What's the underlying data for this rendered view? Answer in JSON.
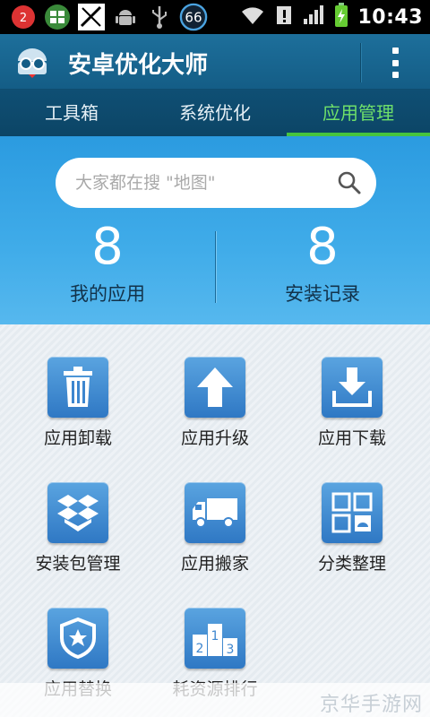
{
  "status_bar": {
    "notification_badge": "2",
    "signal_number": "66",
    "time": "10:43"
  },
  "app": {
    "title": "安卓优化大师",
    "logo_icon": "android-robot-glasses-icon"
  },
  "tabs": [
    {
      "label": "工具箱",
      "active": false
    },
    {
      "label": "系统优化",
      "active": false
    },
    {
      "label": "应用管理",
      "active": true
    }
  ],
  "search": {
    "placeholder": "大家都在搜 \"地图\""
  },
  "counters": [
    {
      "value": "8",
      "label": "我的应用"
    },
    {
      "value": "8",
      "label": "安装记录"
    }
  ],
  "grid": [
    {
      "label": "应用卸载",
      "icon": "trash-icon"
    },
    {
      "label": "应用升级",
      "icon": "arrow-up-icon"
    },
    {
      "label": "应用下载",
      "icon": "download-icon"
    },
    {
      "label": "安装包管理",
      "icon": "package-box-icon"
    },
    {
      "label": "应用搬家",
      "icon": "truck-icon"
    },
    {
      "label": "分类整理",
      "icon": "category-grid-icon"
    },
    {
      "label": "应用替换",
      "icon": "star-shield-icon"
    },
    {
      "label": "耗资源排行",
      "icon": "podium-ranking-icon"
    }
  ],
  "watermark": "京华手游网",
  "colors": {
    "titlebar": "#1d6f9b",
    "tabs_bg": "#0f4f74",
    "active_tab": "#46c43f",
    "header": "#40ace9",
    "icon_tile": "#3d86cf"
  }
}
